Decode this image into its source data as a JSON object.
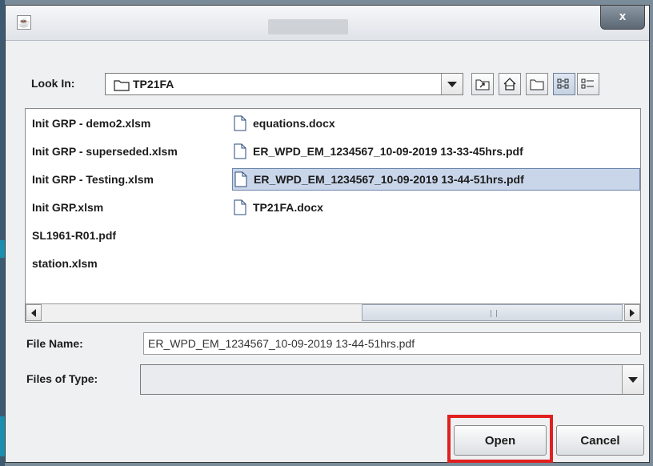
{
  "window": {
    "title_icon": "java-coffee-icon",
    "close_label": "x"
  },
  "look_in": {
    "label": "Look In:",
    "value": "TP21FA"
  },
  "toolbar": {
    "icons": [
      "up-one-level-icon",
      "home-icon",
      "new-folder-icon",
      "list-view-icon",
      "details-view-icon"
    ]
  },
  "files": {
    "column1": [
      "Init GRP - demo2.xlsm",
      "Init GRP - superseded.xlsm",
      "Init GRP - Testing.xlsm",
      "Init GRP.xlsm",
      "SL1961-R01.pdf",
      "station.xlsm"
    ],
    "column2": [
      "equations.docx",
      "ER_WPD_EM_1234567_10-09-2019 13-33-45hrs.pdf",
      "ER_WPD_EM_1234567_10-09-2019 13-44-51hrs.pdf",
      "TP21FA.docx"
    ],
    "selected": "ER_WPD_EM_1234567_10-09-2019 13-44-51hrs.pdf"
  },
  "file_name": {
    "label": "File Name:",
    "value": "ER_WPD_EM_1234567_10-09-2019 13-44-51hrs.pdf"
  },
  "files_of_type": {
    "label": "Files of Type:",
    "value": ""
  },
  "buttons": {
    "open": "Open",
    "cancel": "Cancel"
  },
  "colors": {
    "highlight": "#e02020",
    "selection": "#c9d6ea"
  }
}
